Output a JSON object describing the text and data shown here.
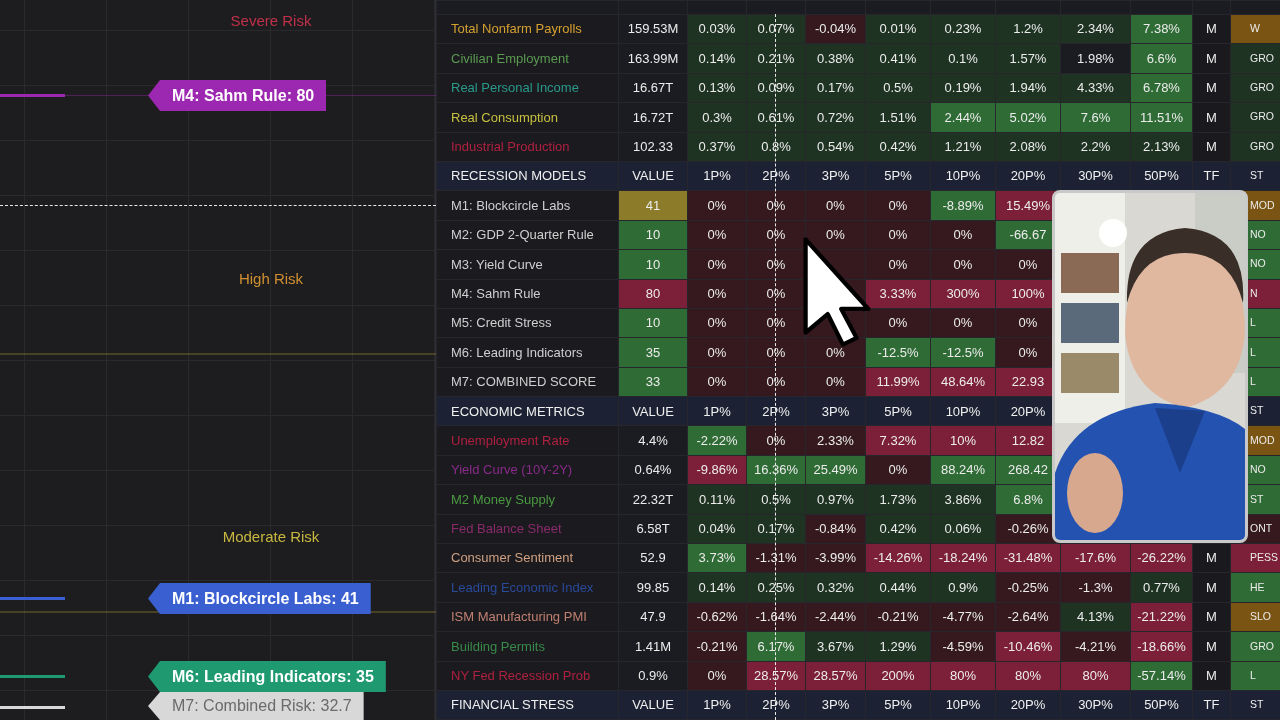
{
  "chart": {
    "zones": [
      {
        "label": "Severe Risk",
        "color": "#c0304a"
      },
      {
        "label": "High Risk",
        "color": "#d09030"
      },
      {
        "label": "Moderate Risk",
        "color": "#c8b840"
      }
    ],
    "series_tags": [
      {
        "label": "M4: Sahm Rule: 80",
        "color": "#9c27b0"
      },
      {
        "label": "M1: Blockcircle Labs: 41",
        "color": "#3a5fd0"
      },
      {
        "label": "M6: Leading Indicators: 35",
        "color": "#1f9a70"
      },
      {
        "label": "M7: Combined Risk: 32.7",
        "color": "#d8d8d8"
      }
    ]
  },
  "table": {
    "rows": [
      {
        "kind": "metric",
        "name": "Total Nonfarm Payrolls",
        "color": "#d4a030",
        "value": {
          "text": "159.53M",
          "color": "#1b1c22"
        },
        "cells": [
          {
            "text": "0.03%",
            "color": "#1e3322"
          },
          {
            "text": "0.07%",
            "color": "#1e3322"
          },
          {
            "text": "-0.04%",
            "color": "#35191f"
          },
          {
            "text": "0.01%",
            "color": "#1e3322"
          },
          {
            "text": "0.23%",
            "color": "#1e3322"
          },
          {
            "text": "1.2%",
            "color": "#1e3322"
          },
          {
            "text": "2.34%",
            "color": "#1e3322"
          },
          {
            "text": "7.38%",
            "color": "#2f6b35"
          }
        ],
        "tf": "M",
        "status": {
          "text": "W",
          "color": "#7a5412"
        }
      },
      {
        "kind": "metric",
        "name": "Civilian Employment",
        "color": "#5a9a50",
        "value": {
          "text": "163.99M",
          "color": "#1b1c22"
        },
        "cells": [
          {
            "text": "0.14%",
            "color": "#1e3322"
          },
          {
            "text": "0.21%",
            "color": "#1e3322"
          },
          {
            "text": "0.38%",
            "color": "#1e3322"
          },
          {
            "text": "0.41%",
            "color": "#1e3322"
          },
          {
            "text": "0.1%",
            "color": "#1e3322"
          },
          {
            "text": "1.57%",
            "color": "#1e3322"
          },
          {
            "text": "1.98%",
            "color": "#1b1c22"
          },
          {
            "text": "6.6%",
            "color": "#2f6b35"
          }
        ],
        "tf": "M",
        "status": {
          "text": "GRO",
          "color": "#1e3322"
        }
      },
      {
        "kind": "metric",
        "name": "Real Personal Income",
        "color": "#2a9a8a",
        "value": {
          "text": "16.67T",
          "color": "#1b1c22"
        },
        "cells": [
          {
            "text": "0.13%",
            "color": "#1e3322"
          },
          {
            "text": "0.09%",
            "color": "#1e3322"
          },
          {
            "text": "0.17%",
            "color": "#1e3322"
          },
          {
            "text": "0.5%",
            "color": "#1e3322"
          },
          {
            "text": "0.19%",
            "color": "#1e3322"
          },
          {
            "text": "1.94%",
            "color": "#1e3322"
          },
          {
            "text": "4.33%",
            "color": "#1e3322"
          },
          {
            "text": "6.78%",
            "color": "#2f6b35"
          }
        ],
        "tf": "M",
        "status": {
          "text": "GRO",
          "color": "#1e3322"
        }
      },
      {
        "kind": "metric",
        "name": "Real Consumption",
        "color": "#c8c040",
        "value": {
          "text": "16.72T",
          "color": "#1b1c22"
        },
        "cells": [
          {
            "text": "0.3%",
            "color": "#1e3322"
          },
          {
            "text": "0.61%",
            "color": "#1e3322"
          },
          {
            "text": "0.72%",
            "color": "#1e3322"
          },
          {
            "text": "1.51%",
            "color": "#1e3322"
          },
          {
            "text": "2.44%",
            "color": "#2f6b35"
          },
          {
            "text": "5.02%",
            "color": "#2f6b35"
          },
          {
            "text": "7.6%",
            "color": "#2f6b35"
          },
          {
            "text": "11.51%",
            "color": "#2f6b35"
          }
        ],
        "tf": "M",
        "status": {
          "text": "GRO",
          "color": "#1e3322"
        }
      },
      {
        "kind": "metric",
        "name": "Industrial Production",
        "color": "#b02040",
        "value": {
          "text": "102.33",
          "color": "#1b1c22"
        },
        "cells": [
          {
            "text": "0.37%",
            "color": "#1e3322"
          },
          {
            "text": "0.8%",
            "color": "#1e3322"
          },
          {
            "text": "0.54%",
            "color": "#1e3322"
          },
          {
            "text": "0.42%",
            "color": "#1e3322"
          },
          {
            "text": "1.21%",
            "color": "#1e3322"
          },
          {
            "text": "2.08%",
            "color": "#1e3322"
          },
          {
            "text": "2.2%",
            "color": "#1e3322"
          },
          {
            "text": "2.13%",
            "color": "#1e3322"
          }
        ],
        "tf": "M",
        "status": {
          "text": "GRO",
          "color": "#1e3322"
        }
      },
      {
        "kind": "header",
        "cells": [
          "RECESSION MODELS",
          "VALUE",
          "1P%",
          "2P%",
          "3P%",
          "5P%",
          "10P%",
          "20P%",
          "30P%",
          "50P%",
          "TF",
          "ST"
        ]
      },
      {
        "kind": "metric",
        "name": "M1: Blockcircle Labs",
        "color": "#cfcfcf",
        "value": {
          "text": "41",
          "color": "#8c7c2a"
        },
        "cells": [
          {
            "text": "0%",
            "color": "#35191f"
          },
          {
            "text": "0%",
            "color": "#35191f"
          },
          {
            "text": "0%",
            "color": "#35191f"
          },
          {
            "text": "0%",
            "color": "#35191f"
          },
          {
            "text": "-8.89%",
            "color": "#2f6b35"
          },
          {
            "text": "15.49%",
            "color": "#7c1f38"
          },
          null,
          null
        ],
        "tf": null,
        "status": {
          "text": "MOD",
          "color": "#7a5412"
        }
      },
      {
        "kind": "metric",
        "name": "M2: GDP 2-Quarter Rule",
        "color": "#cfcfcf",
        "value": {
          "text": "10",
          "color": "#2f6b35"
        },
        "cells": [
          {
            "text": "0%",
            "color": "#35191f"
          },
          {
            "text": "0%",
            "color": "#35191f"
          },
          {
            "text": "0%",
            "color": "#35191f"
          },
          {
            "text": "0%",
            "color": "#35191f"
          },
          {
            "text": "0%",
            "color": "#35191f"
          },
          {
            "text": "-66.67",
            "color": "#2f6b35"
          },
          null,
          null
        ],
        "tf": null,
        "status": {
          "text": "NO",
          "color": "#2f6b35"
        }
      },
      {
        "kind": "metric",
        "name": "M3: Yield Curve",
        "color": "#cfcfcf",
        "value": {
          "text": "10",
          "color": "#2f6b35"
        },
        "cells": [
          {
            "text": "0%",
            "color": "#35191f"
          },
          {
            "text": "0%",
            "color": "#35191f"
          },
          {
            "color": "#35191f"
          },
          {
            "text": "0%",
            "color": "#35191f"
          },
          {
            "text": "0%",
            "color": "#35191f"
          },
          {
            "text": "0%",
            "color": "#35191f"
          },
          null,
          null
        ],
        "tf": null,
        "status": {
          "text": "NO",
          "color": "#2f6b35"
        }
      },
      {
        "kind": "metric",
        "name": "M4: Sahm Rule",
        "color": "#cfcfcf",
        "value": {
          "text": "80",
          "color": "#7c1f38"
        },
        "cells": [
          {
            "text": "0%",
            "color": "#35191f"
          },
          {
            "text": "0%",
            "color": "#35191f"
          },
          {
            "color": "#35191f"
          },
          {
            "text": "3.33%",
            "color": "#7c1f38"
          },
          {
            "text": "300%",
            "color": "#7c1f38"
          },
          {
            "text": "100%",
            "color": "#7c1f38"
          },
          null,
          null
        ],
        "tf": null,
        "status": {
          "text": "N",
          "color": "#7c1f38"
        }
      },
      {
        "kind": "metric",
        "name": "M5: Credit Stress",
        "color": "#cfcfcf",
        "value": {
          "text": "10",
          "color": "#2f6b35"
        },
        "cells": [
          {
            "text": "0%",
            "color": "#35191f"
          },
          {
            "text": "0%",
            "color": "#35191f"
          },
          {
            "color": "#35191f"
          },
          {
            "text": "0%",
            "color": "#35191f"
          },
          {
            "text": "0%",
            "color": "#35191f"
          },
          {
            "text": "0%",
            "color": "#35191f"
          },
          null,
          null
        ],
        "tf": null,
        "status": {
          "text": "L",
          "color": "#2f6b35"
        }
      },
      {
        "kind": "metric",
        "name": "M6: Leading Indicators",
        "color": "#cfcfcf",
        "value": {
          "text": "35",
          "color": "#2f6b35"
        },
        "cells": [
          {
            "text": "0%",
            "color": "#35191f"
          },
          {
            "text": "0%",
            "color": "#35191f"
          },
          {
            "text": "0%",
            "color": "#35191f"
          },
          {
            "text": "-12.5%",
            "color": "#2f6b35"
          },
          {
            "text": "-12.5%",
            "color": "#2f6b35"
          },
          {
            "text": "0%",
            "color": "#35191f"
          },
          null,
          null
        ],
        "tf": null,
        "status": {
          "text": "L",
          "color": "#2f6b35"
        }
      },
      {
        "kind": "metric",
        "name": "M7: COMBINED SCORE",
        "color": "#cfcfcf",
        "value": {
          "text": "33",
          "color": "#2f6b35"
        },
        "cells": [
          {
            "text": "0%",
            "color": "#35191f"
          },
          {
            "text": "0%",
            "color": "#35191f"
          },
          {
            "text": "0%",
            "color": "#35191f"
          },
          {
            "text": "11.99%",
            "color": "#7c1f38"
          },
          {
            "text": "48.64%",
            "color": "#7c1f38"
          },
          {
            "text": "22.93",
            "color": "#7c1f38"
          },
          null,
          null
        ],
        "tf": null,
        "status": {
          "text": "L",
          "color": "#2f6b35"
        }
      },
      {
        "kind": "header",
        "cells": [
          "ECONOMIC METRICS",
          "VALUE",
          "1P%",
          "2P%",
          "3P%",
          "5P%",
          "10P%",
          "20P%",
          null,
          null,
          null,
          "ST"
        ]
      },
      {
        "kind": "metric",
        "name": "Unemployment Rate",
        "color": "#b02040",
        "value": {
          "text": "4.4%",
          "color": "#1b1c22"
        },
        "cells": [
          {
            "text": "-2.22%",
            "color": "#2f6b35"
          },
          {
            "text": "0%",
            "color": "#35191f"
          },
          {
            "text": "2.33%",
            "color": "#35191f"
          },
          {
            "text": "7.32%",
            "color": "#7c1f38"
          },
          {
            "text": "10%",
            "color": "#7c1f38"
          },
          {
            "text": "12.82",
            "color": "#7c1f38"
          },
          null,
          null
        ],
        "tf": null,
        "status": {
          "text": "MOD",
          "color": "#7a5412"
        }
      },
      {
        "kind": "metric",
        "name": "Yield Curve (10Y-2Y)",
        "color": "#8a2a8a",
        "value": {
          "text": "0.64%",
          "color": "#1b1c22"
        },
        "cells": [
          {
            "text": "-9.86%",
            "color": "#7c1f38"
          },
          {
            "text": "16.36%",
            "color": "#2f6b35"
          },
          {
            "text": "25.49%",
            "color": "#2f6b35"
          },
          {
            "text": "0%",
            "color": "#35191f"
          },
          {
            "text": "88.24%",
            "color": "#2f6b35"
          },
          {
            "text": "268.42",
            "color": "#2f6b35"
          },
          null,
          null
        ],
        "tf": null,
        "status": {
          "text": "NO",
          "color": "#2f6b35"
        }
      },
      {
        "kind": "metric",
        "name": "M2 Money Supply",
        "color": "#4a9a40",
        "value": {
          "text": "22.32T",
          "color": "#1b1c22"
        },
        "cells": [
          {
            "text": "0.11%",
            "color": "#1e3322"
          },
          {
            "text": "0.5%",
            "color": "#1e3322"
          },
          {
            "text": "0.97%",
            "color": "#1e3322"
          },
          {
            "text": "1.73%",
            "color": "#1e3322"
          },
          {
            "text": "3.86%",
            "color": "#1e3322"
          },
          {
            "text": "6.8%",
            "color": "#2f6b35"
          },
          null,
          null
        ],
        "tf": null,
        "status": {
          "text": "ST",
          "color": "#2f6b35"
        }
      },
      {
        "kind": "metric",
        "name": "Fed Balance Sheet",
        "color": "#8a2a6a",
        "value": {
          "text": "6.58T",
          "color": "#1b1c22"
        },
        "cells": [
          {
            "text": "0.04%",
            "color": "#1e3322"
          },
          {
            "text": "0.17%",
            "color": "#1e3322"
          },
          {
            "text": "-0.84%",
            "color": "#35191f"
          },
          {
            "text": "0.42%",
            "color": "#1e3322"
          },
          {
            "text": "0.06%",
            "color": "#1e3322"
          },
          {
            "text": "-0.26%",
            "color": "#35191f"
          },
          null,
          null
        ],
        "tf": null,
        "status": {
          "text": "ONT",
          "color": "#35191f"
        }
      },
      {
        "kind": "metric",
        "name": "Consumer Sentiment",
        "color": "#d0a080",
        "value": {
          "text": "52.9",
          "color": "#1b1c22"
        },
        "cells": [
          {
            "text": "3.73%",
            "color": "#2f6b35"
          },
          {
            "text": "-1.31%",
            "color": "#35191f"
          },
          {
            "text": "-3.99%",
            "color": "#35191f"
          },
          {
            "text": "-14.26%",
            "color": "#7c1f38"
          },
          {
            "text": "-18.24%",
            "color": "#7c1f38"
          },
          {
            "text": "-31.48%",
            "color": "#7c1f38"
          },
          {
            "text": "-17.6%",
            "color": "#7c1f38"
          },
          {
            "text": "-26.22%",
            "color": "#7c1f38"
          }
        ],
        "tf": "M",
        "status": {
          "text": "PESS",
          "color": "#7c1f38"
        }
      },
      {
        "kind": "metric",
        "name": "Leading Economic Index",
        "color": "#2a4a9a",
        "value": {
          "text": "99.85",
          "color": "#1b1c22"
        },
        "cells": [
          {
            "text": "0.14%",
            "color": "#1e3322"
          },
          {
            "text": "0.25%",
            "color": "#1e3322"
          },
          {
            "text": "0.32%",
            "color": "#1e3322"
          },
          {
            "text": "0.44%",
            "color": "#1e3322"
          },
          {
            "text": "0.9%",
            "color": "#1e3322"
          },
          {
            "text": "-0.25%",
            "color": "#35191f"
          },
          {
            "text": "-1.3%",
            "color": "#35191f"
          },
          {
            "text": "0.77%",
            "color": "#1e3322"
          }
        ],
        "tf": "M",
        "status": {
          "text": "HE",
          "color": "#2f6b35"
        }
      },
      {
        "kind": "metric",
        "name": "ISM Manufacturing PMI",
        "color": "#c08070",
        "value": {
          "text": "47.9",
          "color": "#1b1c22"
        },
        "cells": [
          {
            "text": "-0.62%",
            "color": "#35191f"
          },
          {
            "text": "-1.64%",
            "color": "#35191f"
          },
          {
            "text": "-2.44%",
            "color": "#35191f"
          },
          {
            "text": "-0.21%",
            "color": "#35191f"
          },
          {
            "text": "-4.77%",
            "color": "#35191f"
          },
          {
            "text": "-2.64%",
            "color": "#35191f"
          },
          {
            "text": "4.13%",
            "color": "#1e3322"
          },
          {
            "text": "-21.22%",
            "color": "#7c1f38"
          }
        ],
        "tf": "M",
        "status": {
          "text": "SLO",
          "color": "#7a5412"
        }
      },
      {
        "kind": "metric",
        "name": "Building Permits",
        "color": "#3a8a4a",
        "value": {
          "text": "1.41M",
          "color": "#1b1c22"
        },
        "cells": [
          {
            "text": "-0.21%",
            "color": "#35191f"
          },
          {
            "text": "6.17%",
            "color": "#2f6b35"
          },
          {
            "text": "3.67%",
            "color": "#1e3322"
          },
          {
            "text": "1.29%",
            "color": "#1e3322"
          },
          {
            "text": "-4.59%",
            "color": "#35191f"
          },
          {
            "text": "-10.46%",
            "color": "#7c1f38"
          },
          {
            "text": "-4.21%",
            "color": "#35191f"
          },
          {
            "text": "-18.66%",
            "color": "#7c1f38"
          }
        ],
        "tf": "M",
        "status": {
          "text": "GRO",
          "color": "#2f6b35"
        }
      },
      {
        "kind": "metric",
        "name": "NY Fed Recession Prob",
        "color": "#b02040",
        "value": {
          "text": "0.9%",
          "color": "#1b1c22"
        },
        "cells": [
          {
            "text": "0%",
            "color": "#35191f"
          },
          {
            "text": "28.57%",
            "color": "#7c1f38"
          },
          {
            "text": "28.57%",
            "color": "#7c1f38"
          },
          {
            "text": "200%",
            "color": "#7c1f38"
          },
          {
            "text": "80%",
            "color": "#7c1f38"
          },
          {
            "text": "80%",
            "color": "#7c1f38"
          },
          {
            "text": "80%",
            "color": "#7c1f38"
          },
          {
            "text": "-57.14%",
            "color": "#2f6b35"
          }
        ],
        "tf": "M",
        "status": {
          "text": "L",
          "color": "#2f6b35"
        }
      },
      {
        "kind": "header",
        "cells": [
          "FINANCIAL STRESS",
          "VALUE",
          "1P%",
          "2P%",
          "3P%",
          "5P%",
          "10P%",
          "20P%",
          "30P%",
          "50P%",
          "TF",
          "ST"
        ]
      }
    ]
  }
}
